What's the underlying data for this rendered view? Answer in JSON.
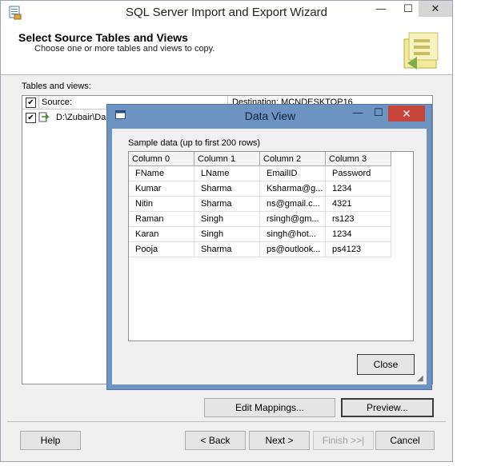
{
  "window": {
    "title": "SQL Server Import and Export Wizard",
    "minimize_glyph": "—",
    "maximize_glyph": "☐",
    "close_glyph": "✕"
  },
  "header": {
    "title": "Select Source Tables and Views",
    "subtitle": "Choose one or more tables and views to copy."
  },
  "tables": {
    "label": "Tables and views:",
    "source_header": "Source:",
    "destination_header": "Destination: MCNDESKTOP16",
    "rows": [
      {
        "source": "D:\\Zubair\\Da",
        "checked": true
      }
    ]
  },
  "buttons": {
    "edit_mappings": "Edit Mappings...",
    "preview": "Preview...",
    "help": "Help",
    "back": "< Back",
    "next": "Next >",
    "finish": "Finish >>|",
    "cancel": "Cancel"
  },
  "dialog": {
    "title": "Data View",
    "sample_label": "Sample data (up to first 200 rows)",
    "close_button": "Close",
    "columns": [
      "Column 0",
      "Column 1",
      "Column 2",
      "Column 3"
    ],
    "rows": [
      [
        "FName",
        "LName",
        "EmailID",
        "Password"
      ],
      [
        "Kumar",
        "Sharma",
        "Ksharma@g...",
        "1234"
      ],
      [
        "Nitin",
        "Sharma",
        "ns@gmail.c...",
        "4321"
      ],
      [
        "Raman",
        "Singh",
        "rsingh@gm...",
        "rs123"
      ],
      [
        "Karan",
        "Singh",
        "singh@hot...",
        "1234"
      ],
      [
        "Pooja",
        "Sharma",
        "ps@outlook...",
        "ps4123"
      ]
    ]
  },
  "icons": {
    "app": "wizard-app-icon",
    "header": "folder-tables-icon",
    "dialog": "window-icon",
    "table": "table-arrow-icon"
  },
  "colors": {
    "dialog_frame": "#6c93c1",
    "close_red": "#c7453a"
  }
}
